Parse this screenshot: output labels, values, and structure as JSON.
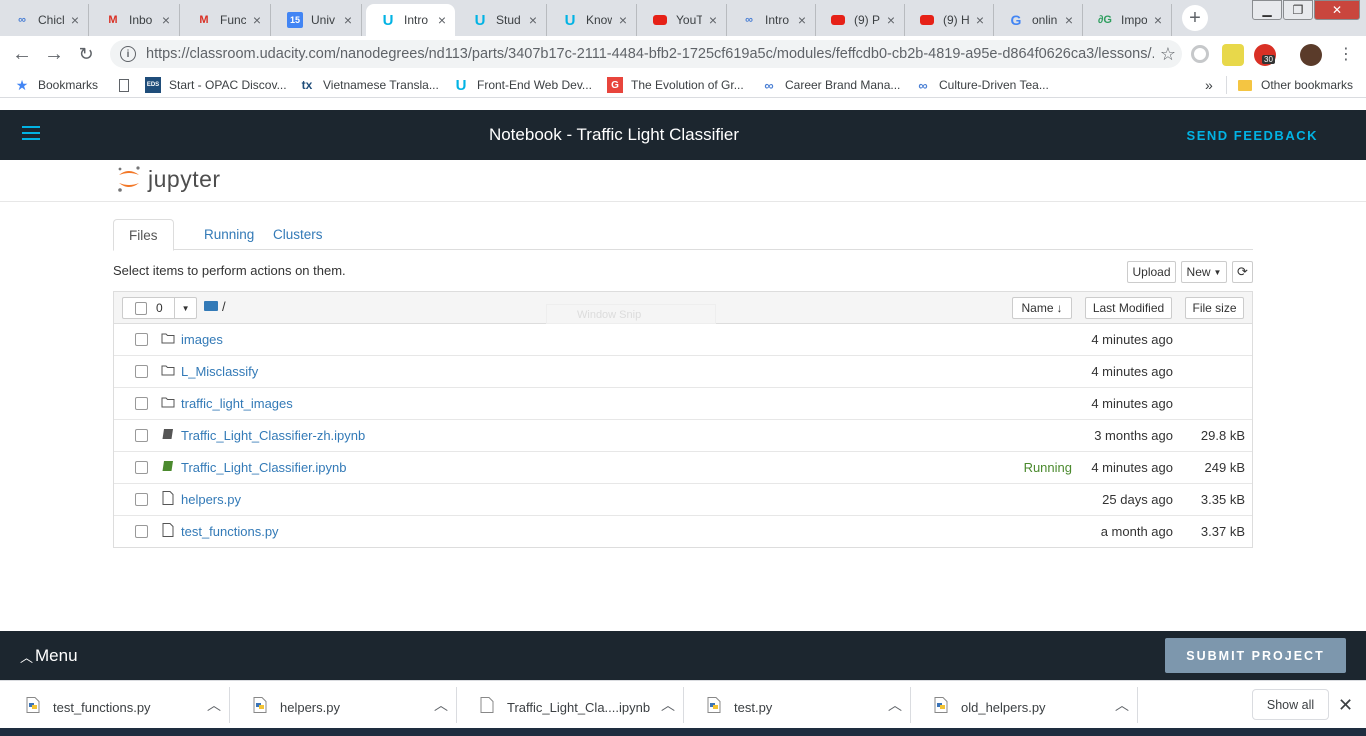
{
  "browser": {
    "tabs": [
      {
        "title": "Chicl",
        "icon": "link-icon"
      },
      {
        "title": "Inbo",
        "icon": "gmail-icon"
      },
      {
        "title": "Func",
        "icon": "gmail-icon"
      },
      {
        "title": "Univ",
        "icon": "calendar-icon"
      },
      {
        "title": "Intro",
        "icon": "udacity-icon",
        "active": true
      },
      {
        "title": "Stud",
        "icon": "udacity-icon"
      },
      {
        "title": "Know",
        "icon": "udacity-icon"
      },
      {
        "title": "YouT",
        "icon": "youtube-icon"
      },
      {
        "title": "Intro",
        "icon": "link-icon"
      },
      {
        "title": "(9) P",
        "icon": "youtube-icon"
      },
      {
        "title": "(9) H",
        "icon": "youtube-icon"
      },
      {
        "title": "onlin",
        "icon": "google-icon"
      },
      {
        "title": "Impo",
        "icon": "translate-icon"
      }
    ],
    "url": "https://classroom.udacity.com/nanodegrees/nd113/parts/3407b17c-2111-4484-bfb2-1725cf619a5c/modules/feffcdb0-cb2b-4819-a95e-d864f0626ca3/lessons/...",
    "extension_badge": "30",
    "bookmarks": [
      {
        "label": "Bookmarks",
        "icon": "star-icon"
      },
      {
        "label": "",
        "icon": "page-icon"
      },
      {
        "label": "Start - OPAC Discov...",
        "icon": "eds-icon"
      },
      {
        "label": "Vietnamese Transla...",
        "icon": "tx-icon"
      },
      {
        "label": "Front-End Web Dev...",
        "icon": "udacity-icon"
      },
      {
        "label": "The Evolution of Gr...",
        "icon": "g-icon"
      },
      {
        "label": "Career Brand Mana...",
        "icon": "link-icon"
      },
      {
        "label": "Culture-Driven Tea...",
        "icon": "link-icon"
      }
    ],
    "bookmarks_overflow": "»",
    "other_bookmarks": "Other bookmarks"
  },
  "udacity": {
    "title": "Notebook - Traffic Light Classifier",
    "send_feedback": "SEND FEEDBACK",
    "menu_label": "Menu",
    "submit_label": "SUBMIT PROJECT"
  },
  "jupyter": {
    "logo_text": "jupyter",
    "tabs": [
      "Files",
      "Running",
      "Clusters"
    ],
    "hint": "Select items to perform actions on them.",
    "upload_label": "Upload",
    "new_label": "New",
    "selected_count": "0",
    "path": "/",
    "columns": {
      "name": "Name",
      "modified": "Last Modified",
      "size": "File size"
    },
    "overlay_text": "Window Snip",
    "files": [
      {
        "type": "folder",
        "name": "images",
        "status": "",
        "modified": "4 minutes ago",
        "size": ""
      },
      {
        "type": "folder",
        "name": "L_Misclassify",
        "status": "",
        "modified": "4 minutes ago",
        "size": ""
      },
      {
        "type": "folder",
        "name": "traffic_light_images",
        "status": "",
        "modified": "4 minutes ago",
        "size": ""
      },
      {
        "type": "notebook",
        "name": "Traffic_Light_Classifier-zh.ipynb",
        "status": "",
        "modified": "3 months ago",
        "size": "29.8 kB"
      },
      {
        "type": "notebook-running",
        "name": "Traffic_Light_Classifier.ipynb",
        "status": "Running",
        "modified": "4 minutes ago",
        "size": "249 kB"
      },
      {
        "type": "file",
        "name": "helpers.py",
        "status": "",
        "modified": "25 days ago",
        "size": "3.35 kB"
      },
      {
        "type": "file",
        "name": "test_functions.py",
        "status": "",
        "modified": "a month ago",
        "size": "3.37 kB"
      }
    ]
  },
  "downloads": {
    "items": [
      {
        "name": "test_functions.py",
        "icon": "python-file-icon"
      },
      {
        "name": "helpers.py",
        "icon": "python-file-icon"
      },
      {
        "name": "Traffic_Light_Cla....ipynb",
        "icon": "file-icon"
      },
      {
        "name": "test.py",
        "icon": "python-file-icon"
      },
      {
        "name": "old_helpers.py",
        "icon": "python-file-icon"
      }
    ],
    "show_all": "Show all"
  },
  "colors": {
    "udacity_dark": "#1c262f",
    "udacity_blue": "#02b3e4",
    "link_blue": "#337ab7",
    "running_green": "#4b8a2e",
    "submit_gray": "#7d97ad",
    "jupyter_orange": "#f37726"
  }
}
